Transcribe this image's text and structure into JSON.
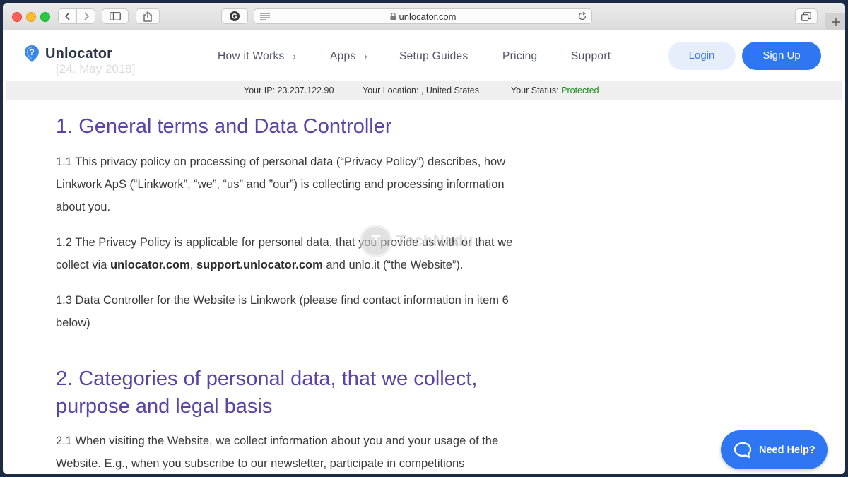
{
  "browser": {
    "url": "unlocator.com"
  },
  "header": {
    "logo_text": "Unlocator",
    "ghost_date": "[24. May 2018]",
    "nav": [
      {
        "label": "How it Works",
        "has_chevron": true
      },
      {
        "label": "Apps",
        "has_chevron": true
      },
      {
        "label": "Setup Guides",
        "has_chevron": false
      },
      {
        "label": "Pricing",
        "has_chevron": false
      },
      {
        "label": "Support",
        "has_chevron": false
      }
    ],
    "login_label": "Login",
    "signup_label": "Sign Up"
  },
  "status_bar": {
    "ip_label": "Your IP:",
    "ip_value": "23.237.122.90",
    "location_label": "Your Location:",
    "location_value": ", United States",
    "status_label": "Your Status:",
    "status_value": "Protected"
  },
  "content": {
    "h1": "1. General terms and Data Controller",
    "p1_1": "1.1 This privacy policy on processing of personal data (“Privacy Policy”) describes, how Linkwork ApS (“Linkwork”, “we”, “us” and ”our”) is collecting and processing information about you.",
    "p1_2_a": "1.2 The Privacy Policy is applicable for personal data, that you provide us with or that we collect via ",
    "p1_2_link1": "unlocator.com",
    "p1_2_sep": ", ",
    "p1_2_link2": "support.unlocator.com",
    "p1_2_b": " and unlo.it (“the Website”).",
    "p1_3": "1.3 Data Controller for the Website is Linkwork (please find contact information in item 6 below)",
    "h2": "2. Categories of personal data, that we collect, purpose and legal basis",
    "p2_1": "2.1 When visiting the Website, we collect information about you and your usage of the Website. E.g., when you subscribe to our newsletter, participate in competitions"
  },
  "watermark": {
    "letter": "T",
    "text": "TechNadu"
  },
  "help": {
    "label": "Need Help?"
  },
  "colors": {
    "heading": "#5b43a8",
    "accent_blue": "#2f76f2",
    "protected_green": "#1f8b1f"
  }
}
